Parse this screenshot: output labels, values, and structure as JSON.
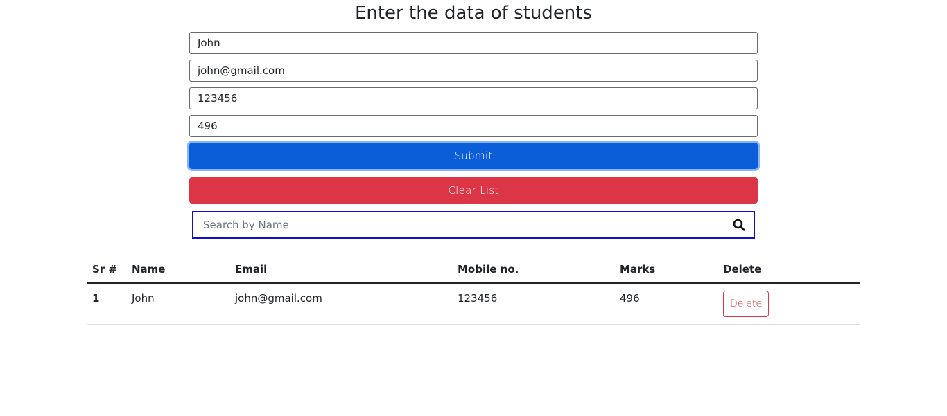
{
  "page": {
    "title": "Enter the data of students"
  },
  "form": {
    "name_value": "John",
    "email_value": "john@gmail.com",
    "mobile_value": "123456",
    "marks_value": "496",
    "submit_label": "Submit",
    "clear_label": "Clear List"
  },
  "search": {
    "placeholder": "Search by Name",
    "icon": "search-icon"
  },
  "table": {
    "headers": [
      "Sr #",
      "Name",
      "Email",
      "Mobile no.",
      "Marks",
      "Delete"
    ],
    "rows": [
      {
        "sr": "1",
        "name": "John",
        "email": "john@gmail.com",
        "mobile": "123456",
        "marks": "496",
        "delete_label": "Delete"
      }
    ]
  },
  "colors": {
    "primary": "#0b5ed7",
    "danger": "#dc3545",
    "search_border": "#1010c8"
  }
}
